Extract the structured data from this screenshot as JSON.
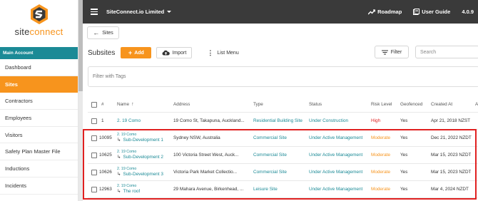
{
  "sidebar": {
    "logo": {
      "prefix": "site",
      "suffix": "connect"
    },
    "section_header": "Main Account",
    "items": [
      {
        "label": "Dashboard",
        "active": false
      },
      {
        "label": "Sites",
        "active": true
      },
      {
        "label": "Contractors",
        "active": false
      },
      {
        "label": "Employees",
        "active": false
      },
      {
        "label": "Visitors",
        "active": false
      },
      {
        "label": "Safety Plan Master File",
        "active": false
      },
      {
        "label": "Inductions",
        "active": false
      },
      {
        "label": "Incidents",
        "active": false
      }
    ]
  },
  "topbar": {
    "org_name": "SiteConnect.io Limited",
    "roadmap_label": "Roadmap",
    "user_guide_label": "User Guide",
    "version": "4.0.9"
  },
  "toolbar": {
    "back_label": "Sites",
    "page_title": "Subsites",
    "add_label": "Add",
    "import_label": "Import",
    "list_menu_label": "List Menu",
    "filter_label": "Filter",
    "search_placeholder": "Search",
    "tags_placeholder": "Filter with Tags"
  },
  "table": {
    "headers": {
      "id": "#",
      "name": "Name",
      "address": "Address",
      "type": "Type",
      "status": "Status",
      "risk": "Risk Level",
      "geofenced": "Geofenced",
      "created": "Created At",
      "extra": "A"
    },
    "rows": [
      {
        "id": "1",
        "parent": "",
        "name": "2. 19 Como",
        "address": "19 Como St, Takapuna, Auckland...",
        "type": "Residential Building Site",
        "status": "Under Construction",
        "risk": "High",
        "geofenced": "Yes",
        "created": "Apr 21, 2018 NZST"
      },
      {
        "id": "10095",
        "parent": "2. 19 Como",
        "name": "Sub-Development 1",
        "address": "Sydney NSW, Australia",
        "type": "Commercial Site",
        "status": "Under Active Management",
        "risk": "Moderate",
        "geofenced": "Yes",
        "created": "Dec 21, 2022 NZDT"
      },
      {
        "id": "10625",
        "parent": "2. 19 Como",
        "name": "Sub-Development 2",
        "address": "100 Victoria Street West, Auck...",
        "type": "Commercial Site",
        "status": "Under Active Management",
        "risk": "Moderate",
        "geofenced": "Yes",
        "created": "Mar 15, 2023 NZDT"
      },
      {
        "id": "10626",
        "parent": "2. 19 Como",
        "name": "Sub-Development 3",
        "address": "Victoria Park Market Collectio...",
        "type": "Commercial Site",
        "status": "Under Active Management",
        "risk": "Moderate",
        "geofenced": "Yes",
        "created": "Mar 15, 2023 NZDT"
      },
      {
        "id": "12963",
        "parent": "2. 19 Como",
        "name": "The roof",
        "address": "29 Mahara Avenue, Birkenhead, ...",
        "type": "Leisure Site",
        "status": "Under Active Management",
        "risk": "Moderate",
        "geofenced": "Yes",
        "created": "Mar 4, 2024 NZDT"
      }
    ]
  },
  "colors": {
    "accent": "#f7941d",
    "teal": "#1b8a96",
    "topbar": "#3a3a3a",
    "highlight": "#e02020"
  }
}
